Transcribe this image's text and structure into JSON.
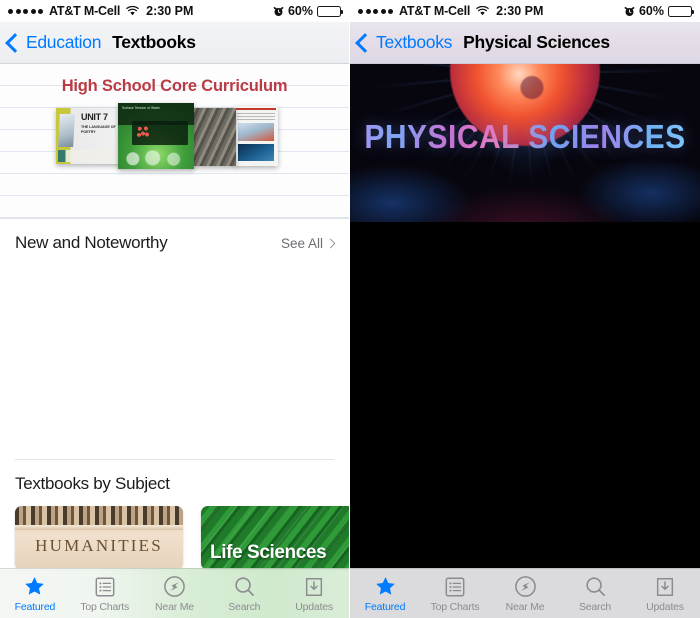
{
  "screens": [
    {
      "id": "textbooks",
      "status_bar": {
        "signal_dots": 5,
        "carrier": "AT&T M-Cell",
        "wifi_icon": "wifi-icon",
        "time": "2:30 PM",
        "alarm_icon": "alarm-clock-icon",
        "battery_percent": "60%",
        "battery_icon": "battery-icon",
        "battery_level": 60
      },
      "nav": {
        "back_icon": "chevron-left-icon",
        "back_label": "Education",
        "title": "Textbooks"
      },
      "hero": {
        "title": "High School Core Curriculum",
        "books": [
          {
            "name": "unit-7-language-of-poetry",
            "unit": "UNIT 7",
            "subtitle": "THE LANGUAGE OF POETRY"
          },
          {
            "name": "surface-tension-of-water",
            "caption": "Surface Tension of Water"
          },
          {
            "name": "geology-rock-photo"
          },
          {
            "name": "science-magazine-page"
          }
        ]
      },
      "sections": [
        {
          "name": "new-and-noteworthy",
          "title": "New and Noteworthy",
          "see_all_label": "See All",
          "see_all_icon": "chevron-right-icon"
        },
        {
          "name": "textbooks-by-subject",
          "title": "Textbooks by Subject",
          "cards": [
            {
              "name": "subject-card-humanities",
              "label": "HUMANITIES"
            },
            {
              "name": "subject-card-life-sciences",
              "label": "Life Sciences"
            }
          ]
        }
      ],
      "tabs": [
        {
          "name": "tab-featured",
          "label": "Featured",
          "icon": "star-icon",
          "active": true
        },
        {
          "name": "tab-top-charts",
          "label": "Top Charts",
          "icon": "list-icon",
          "active": false
        },
        {
          "name": "tab-near-me",
          "label": "Near Me",
          "icon": "compass-icon",
          "active": false
        },
        {
          "name": "tab-search",
          "label": "Search",
          "icon": "search-icon",
          "active": false
        },
        {
          "name": "tab-updates",
          "label": "Updates",
          "icon": "download-icon",
          "active": false
        }
      ]
    },
    {
      "id": "physical-sciences",
      "status_bar": {
        "signal_dots": 5,
        "carrier": "AT&T M-Cell",
        "wifi_icon": "wifi-icon",
        "time": "2:30 PM",
        "alarm_icon": "alarm-clock-icon",
        "battery_percent": "60%",
        "battery_icon": "battery-icon",
        "battery_level": 60
      },
      "nav": {
        "back_icon": "chevron-left-icon",
        "back_label": "Textbooks",
        "title": "Physical Sciences"
      },
      "hero": {
        "title": "PHYSICAL SCIENCES",
        "image_name": "plasma-globe-banner"
      },
      "tabs": [
        {
          "name": "tab-featured",
          "label": "Featured",
          "icon": "star-icon",
          "active": true
        },
        {
          "name": "tab-top-charts",
          "label": "Top Charts",
          "icon": "list-icon",
          "active": false
        },
        {
          "name": "tab-near-me",
          "label": "Near Me",
          "icon": "compass-icon",
          "active": false
        },
        {
          "name": "tab-search",
          "label": "Search",
          "icon": "search-icon",
          "active": false
        },
        {
          "name": "tab-updates",
          "label": "Updates",
          "icon": "download-icon",
          "active": false
        }
      ]
    }
  ],
  "colors": {
    "accent_blue": "#007aff",
    "hero_red": "#b93b44",
    "tab_inactive": "#8c8c90"
  }
}
